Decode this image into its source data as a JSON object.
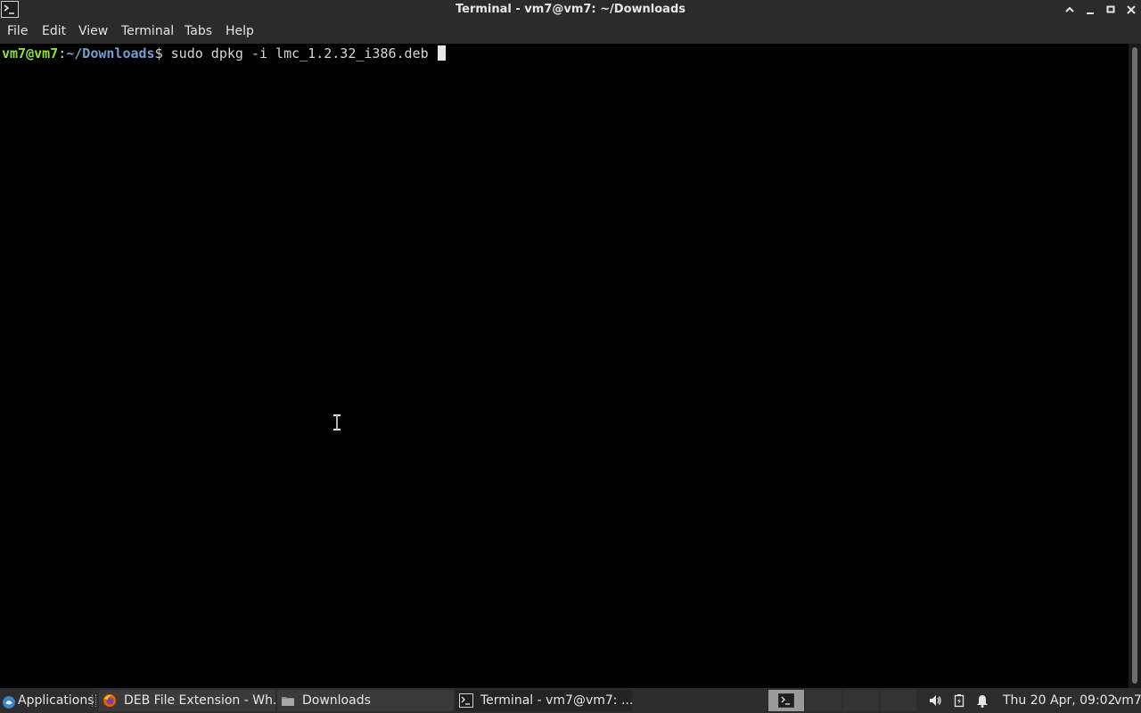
{
  "window": {
    "title": "Terminal - vm7@vm7: ~/Downloads",
    "icon": "terminal-icon",
    "controls": [
      "maximize-up-icon",
      "minimize-icon",
      "restore-icon",
      "close-icon"
    ]
  },
  "menubar": {
    "items": [
      "File",
      "Edit",
      "View",
      "Terminal",
      "Tabs",
      "Help"
    ]
  },
  "terminal": {
    "prompt_user": "vm7@vm7",
    "prompt_sep": ":",
    "prompt_path": "~/Downloads",
    "prompt_symbol": "$",
    "command": " sudo dpkg -i lmc_1.2.32_i386.deb ",
    "colors": {
      "user": "#8ae234",
      "path": "#729fcf",
      "text": "#d3d7cf",
      "background": "#000000"
    }
  },
  "taskbar": {
    "applications_label": "Applications",
    "tasks": [
      {
        "label": "DEB File Extension - Wh...",
        "icon": "firefox-icon"
      },
      {
        "label": "Downloads",
        "icon": "folder-icon"
      },
      {
        "label": "Terminal - vm7@vm7: ...",
        "icon": "terminal-icon"
      }
    ],
    "clock": "Thu 20 Apr, 09:02",
    "user": "vm7",
    "tray_icons": [
      "workspace-icon",
      "volume-icon",
      "battery-icon",
      "notification-bell-icon"
    ]
  }
}
